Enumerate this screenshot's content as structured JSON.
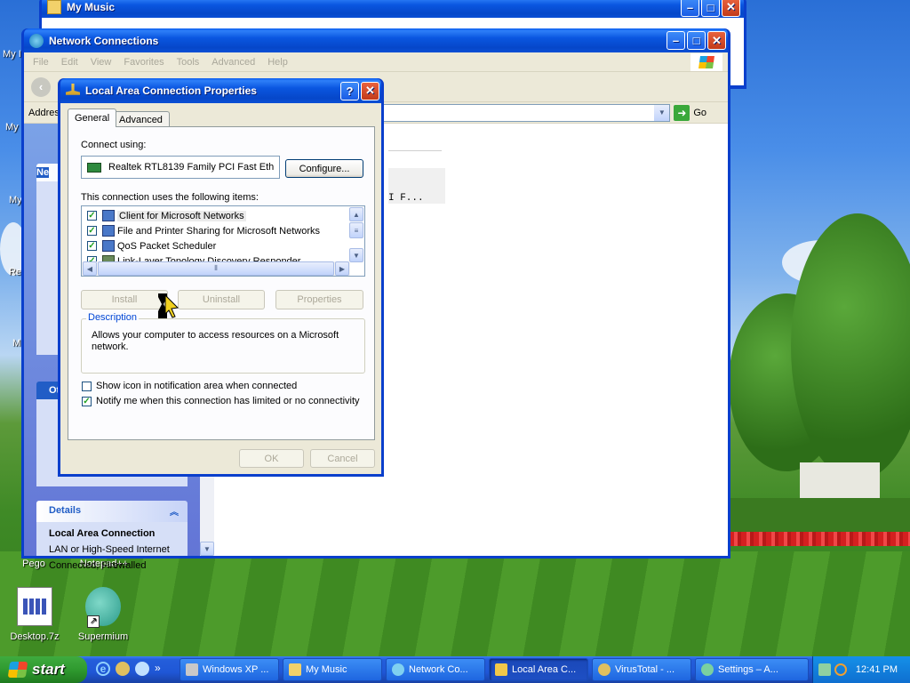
{
  "desktop": {
    "icons": [
      {
        "label": "Pego"
      },
      {
        "label": "Notepad++"
      },
      {
        "label": "Desktop.7z"
      },
      {
        "label": "Supermium"
      }
    ],
    "left_fragments": [
      "My I",
      "My",
      "My",
      "Re",
      "M"
    ]
  },
  "my_music_window": {
    "title": "My Music"
  },
  "network_window": {
    "title": "Network Connections",
    "menu": [
      "File",
      "Edit",
      "View",
      "Favorites",
      "Tools",
      "Advanced",
      "Help"
    ],
    "address_label": "Address",
    "go_label": "Go",
    "truncated_item_text": "I F...",
    "sidebar": {
      "section1_fragment": "Ne",
      "section2_fragment": "Ot",
      "details_header": "Details",
      "details_name": "Local Area Connection",
      "details_line1": "LAN or High-Speed Internet",
      "details_line2": "Connected, Firewalled"
    }
  },
  "dialog": {
    "title": "Local Area Connection Properties",
    "tabs": [
      "General",
      "Advanced"
    ],
    "connect_using_label": "Connect using:",
    "adapter": "Realtek RTL8139 Family PCI Fast Eth",
    "configure_label": "Configure...",
    "items_label": "This connection uses the following items:",
    "items": [
      {
        "label": "Client for Microsoft Networks",
        "checked": true
      },
      {
        "label": "File and Printer Sharing for Microsoft Networks",
        "checked": true
      },
      {
        "label": "QoS Packet Scheduler",
        "checked": true
      },
      {
        "label": "Link-Layer Topology Discovery Responder",
        "checked": true
      }
    ],
    "install_label": "Install",
    "uninstall_label": "Uninstall",
    "properties_label": "Properties",
    "description_legend": "Description",
    "description_text": "Allows your computer to access resources on a Microsoft network.",
    "show_icon_label": "Show icon in notification area when connected",
    "show_icon_checked": false,
    "notify_label": "Notify me when this connection has limited or no connectivity",
    "notify_checked": true,
    "ok_label": "OK",
    "cancel_label": "Cancel",
    "help_glyph": "?",
    "close_glyph": "✕"
  },
  "taskbar": {
    "start_label": "start",
    "items": [
      {
        "label": "Windows XP ..."
      },
      {
        "label": "My Music"
      },
      {
        "label": "Network Co..."
      },
      {
        "label": "Local Area C..."
      },
      {
        "label": "VirusTotal - ..."
      },
      {
        "label": "Settings – A..."
      }
    ],
    "quicklaunch_more": "»",
    "clock": "12:41 PM"
  },
  "colors": {
    "xp_blue": "#0a56e0",
    "dialog_bg": "#ece9d8",
    "link_blue": "#0046d5"
  }
}
